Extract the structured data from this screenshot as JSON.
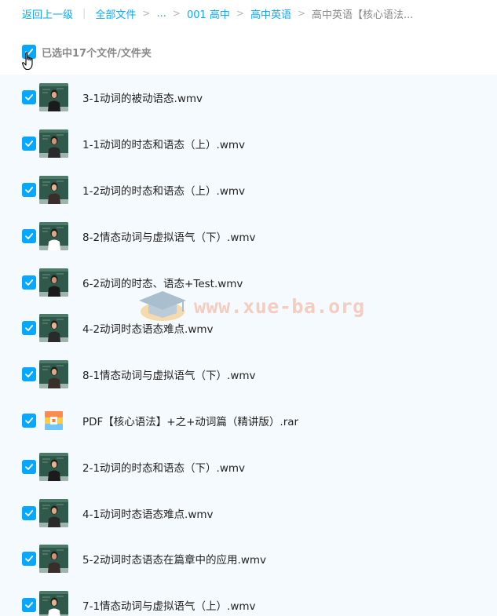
{
  "breadcrumb": {
    "back_label": "返回上一级",
    "all_files_label": "全部文件",
    "ellipsis_label": "...",
    "crumb_1": "001 高中",
    "crumb_2": "高中英语",
    "current": "高中英语【核心语法..."
  },
  "selection": {
    "text": "已选中17个文件/文件夹"
  },
  "watermark": {
    "text": "www.xue-ba.org"
  },
  "files": [
    {
      "name": "3-1动词的被动语态.wmv",
      "type": "video"
    },
    {
      "name": "1-1动词的时态和语态（上）.wmv",
      "type": "video"
    },
    {
      "name": "1-2动词的时态和语态（上）.wmv",
      "type": "video"
    },
    {
      "name": "8-2情态动词与虚拟语气（下）.wmv",
      "type": "video"
    },
    {
      "name": "6-2动词的时态、语态+Test.wmv",
      "type": "video"
    },
    {
      "name": "4-2动词时态语态难点.wmv",
      "type": "video"
    },
    {
      "name": "8-1情态动词与虚拟语气（下）.wmv",
      "type": "video"
    },
    {
      "name": "PDF【核心语法】+之+动词篇（精讲版）.rar",
      "type": "archive"
    },
    {
      "name": "2-1动词的时态和语态（下）.wmv",
      "type": "video"
    },
    {
      "name": "4-1动词时态语态难点.wmv",
      "type": "video"
    },
    {
      "name": "5-2动词时态语态在篇章中的应用.wmv",
      "type": "video"
    },
    {
      "name": "7-1情态动词与虚拟语气（上）.wmv",
      "type": "video"
    }
  ],
  "colors": {
    "accent": "#06a7ff",
    "link": "#09aaff",
    "list_background": "#f5fafe"
  }
}
